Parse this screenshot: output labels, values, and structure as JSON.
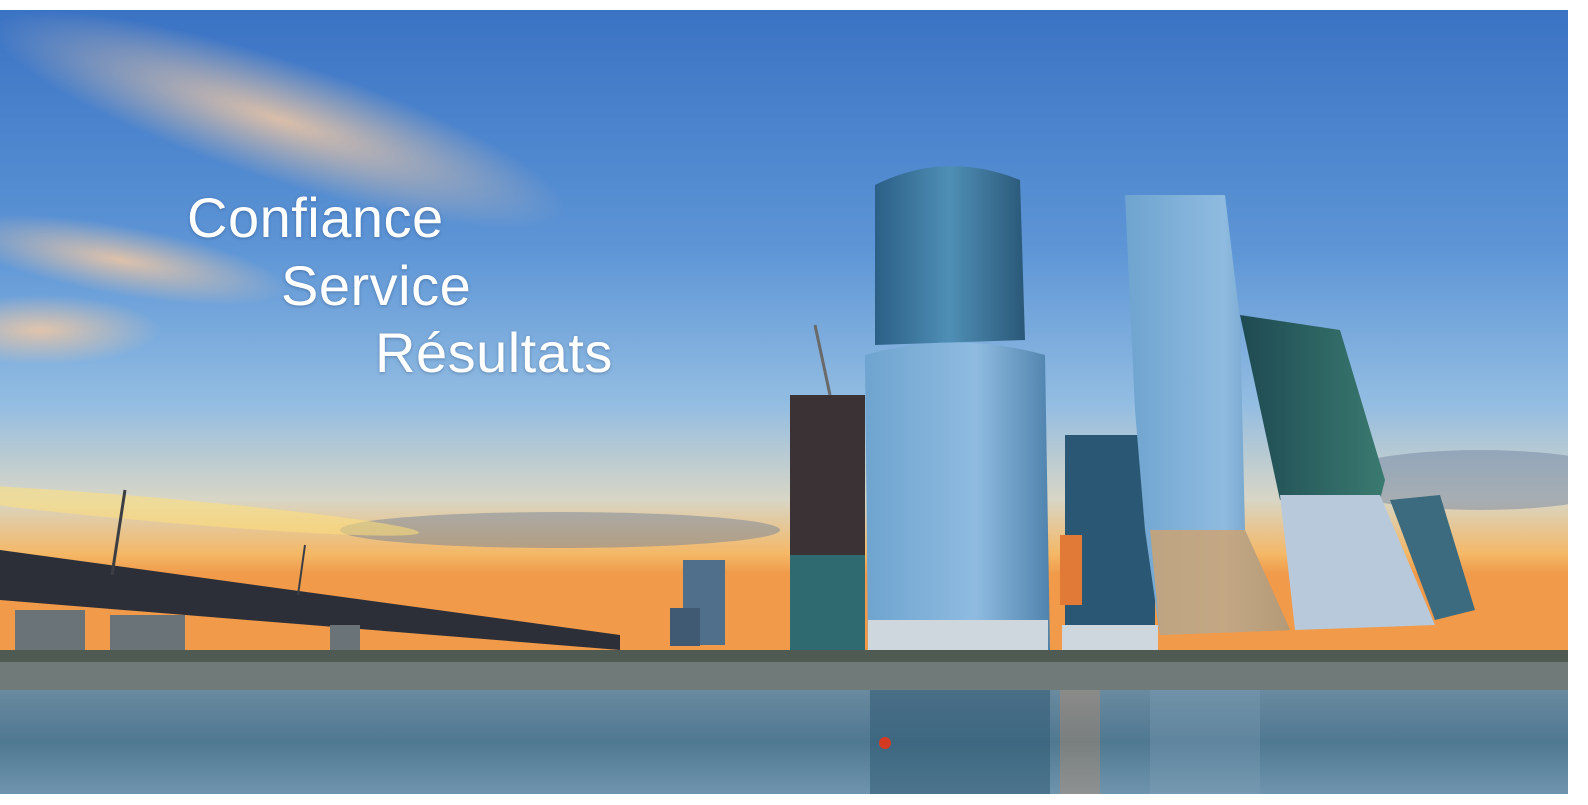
{
  "hero": {
    "taglines": [
      "Confiance",
      "Service",
      "Résultats"
    ]
  },
  "scene": {
    "description_icon": "city-skyline-sunset-photo",
    "colors": {
      "sky_top": "#3f78c8",
      "sky_mid": "#7fb0de",
      "horizon_glow": "#f6b25a",
      "water": "#5a7f98"
    }
  }
}
